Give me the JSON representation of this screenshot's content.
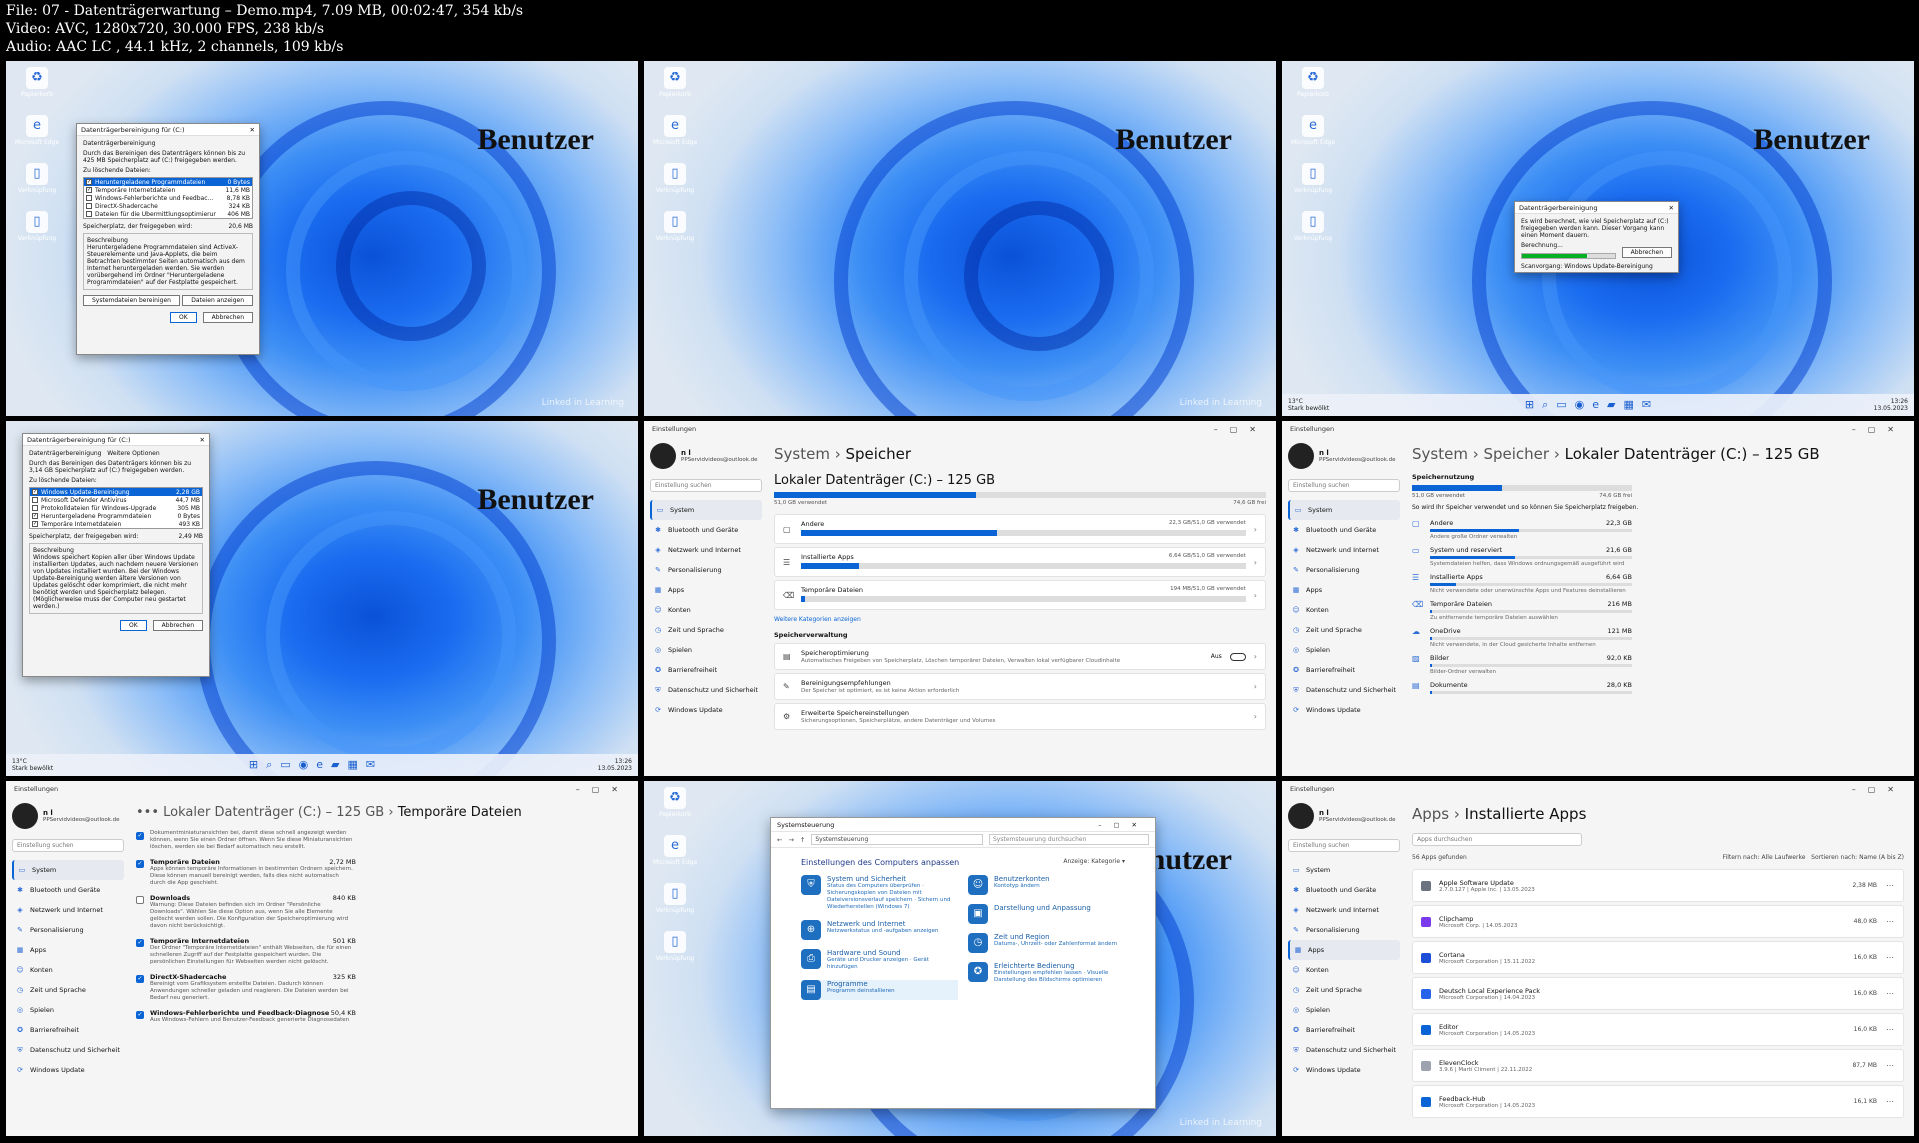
{
  "header": {
    "file_line": "File: 07 - Datenträgerwartung – Demo.mp4, 7.09 MB, 00:02:47, 354 kb/s",
    "video_line": "Video: AVC, 1280x720, 30.000 FPS, 238 kb/s",
    "audio_line": "Audio: AAC LC , 44.1 kHz, 2 channels, 109 kb/s"
  },
  "desktop": {
    "overlay_text": "Benutzer",
    "watermark": "Linked in Learning",
    "icons": [
      "Papierkorb",
      "Microsoft Edge",
      "Verknüpfung",
      "Verknüpfung"
    ],
    "taskbar": {
      "weather_temp": "13°C",
      "weather_desc": "Stark bewölkt",
      "time": "13:26",
      "date": "13.05.2023"
    }
  },
  "cleanup_dialog": {
    "title": "Datenträgerbereinigung für (C:)",
    "tab": "Datenträgerbereinigung",
    "intro": "Durch das Bereinigen des Datenträgers können bis zu 425 MB Speicherplatz auf (C:) freigegeben werden.",
    "files_label": "Zu löschende Dateien:",
    "files": [
      {
        "name": "Heruntergeladene Programmdateien",
        "size": "0 Bytes",
        "checked": true,
        "selected": true
      },
      {
        "name": "Temporäre Internetdateien",
        "size": "11,6 MB",
        "checked": true,
        "selected": false
      },
      {
        "name": "Windows-Fehlerberichte und Feedbac...",
        "size": "8,78 KB",
        "checked": false,
        "selected": false
      },
      {
        "name": "DirectX-Shadercache",
        "size": "324 KB",
        "checked": false,
        "selected": false
      },
      {
        "name": "Dateien für die Übermittlungsoptimierung",
        "size": "406 MB",
        "checked": false,
        "selected": false
      }
    ],
    "space_label": "Speicherplatz, der freigegeben wird:",
    "space_value": "20,6 MB",
    "desc_label": "Beschreibung",
    "desc_text": "Heruntergeladene Programmdateien sind ActiveX-Steuerelemente und Java-Applets, die beim Betrachten bestimmter Seiten automatisch aus dem Internet heruntergeladen werden. Sie werden vorübergehend im Ordner \"Heruntergeladene Programmdateien\" auf der Festplatte gespeichert.",
    "sys_button": "Systemdateien bereinigen",
    "view_button": "Dateien anzeigen",
    "ok": "OK",
    "cancel": "Abbrechen"
  },
  "progress_dialog": {
    "title": "Datenträgerbereinigung",
    "message": "Es wird berechnet, wie viel Speicherplatz auf (C:) freigegeben werden kann. Dieser Vorgang kann einen Moment dauern.",
    "calc_label": "Berechnung...",
    "cancel": "Abbrechen",
    "scan_label": "Scanvorgang:",
    "scan_item": "Windows Update-Bereinigung",
    "progress": 0.7
  },
  "cleanup_dialog2": {
    "title": "Datenträgerbereinigung für (C:)",
    "tabs": [
      "Datenträgerbereinigung",
      "Weitere Optionen"
    ],
    "intro": "Durch das Bereinigen des Datenträgers können bis zu 3,14 GB Speicherplatz auf (C:) freigegeben werden.",
    "files_label": "Zu löschende Dateien:",
    "files": [
      {
        "name": "Windows Update-Bereinigung",
        "size": "2,28 GB",
        "checked": true,
        "selected": true
      },
      {
        "name": "Microsoft Defender Antivirus",
        "size": "44,7 MB",
        "checked": false,
        "selected": false
      },
      {
        "name": "Protokolldateien für Windows-Upgrade",
        "size": "305 MB",
        "checked": false,
        "selected": false
      },
      {
        "name": "Heruntergeladene Programmdateien",
        "size": "0 Bytes",
        "checked": true,
        "selected": false
      },
      {
        "name": "Temporäre Internetdateien",
        "size": "493 KB",
        "checked": true,
        "selected": false
      }
    ],
    "space_label": "Speicherplatz, der freigegeben wird:",
    "space_value": "2,49 MB",
    "desc_label": "Beschreibung",
    "desc_text": "Windows speichert Kopien aller über Windows Update installierten Updates, auch nachdem neuere Versionen von Updates installiert wurden. Bei der Windows Update-Bereinigung werden ältere Versionen von Updates gelöscht oder komprimiert, die nicht mehr benötigt werden und Speicherplatz belegen. (Möglicherweise muss der Computer neu gestartet werden.)",
    "ok": "OK",
    "cancel": "Abbrechen"
  },
  "settings": {
    "app_title": "Einstellungen",
    "user_name": "n l",
    "user_email": "PPServidvideos@outlook.de",
    "search_placeholder": "Einstellung suchen",
    "nav": [
      "System",
      "Bluetooth und Geräte",
      "Netzwerk und Internet",
      "Personalisierung",
      "Apps",
      "Konten",
      "Zeit und Sprache",
      "Spielen",
      "Barrierefreiheit",
      "Datenschutz und Sicherheit",
      "Windows Update"
    ]
  },
  "storage_page": {
    "crumb_parent": "System",
    "crumb_current": "Speicher",
    "drive_title": "Lokaler Datenträger (C:) – 125 GB",
    "used": "51,0 GB verwendet",
    "free": "74,6 GB frei",
    "used_fraction": 0.41,
    "categories": [
      {
        "name": "Andere",
        "value": "22,3 GB/51,0 GB verwendet",
        "fraction": 0.44
      },
      {
        "name": "Installierte Apps",
        "value": "6,64 GB/51,0 GB verwendet",
        "fraction": 0.13
      },
      {
        "name": "Temporäre Dateien",
        "value": "194 MB/51,0 GB verwendet",
        "fraction": 0.01
      }
    ],
    "more_link": "Weitere Kategorien anzeigen",
    "mgmt_title": "Speicherverwaltung",
    "mgmt": [
      {
        "name": "Speicheroptimierung",
        "desc": "Automatisches Freigeben von Speicherplatz, Löschen temporärer Dateien, Verwalten lokal verfügbarer Cloudinhalte",
        "state": "Aus"
      },
      {
        "name": "Bereinigungsempfehlungen",
        "desc": "Der Speicher ist optimiert, es ist keine Aktion erforderlich",
        "state": ""
      },
      {
        "name": "Erweiterte Speichereinstellungen",
        "desc": "Sicherungsoptionen, Speicherplätze, andere Datenträger und Volumes",
        "state": ""
      }
    ]
  },
  "drive_page": {
    "crumb": [
      "System",
      "Speicher",
      "Lokaler Datenträger (C:) – 125 GB"
    ],
    "section": "Speichernutzung",
    "used": "51,0 GB verwendet",
    "free": "74,6 GB frei",
    "used_fraction": 0.41,
    "intro": "So wird Ihr Speicher verwendet und so können Sie Speicherplatz freigeben.",
    "items": [
      {
        "name": "Andere",
        "size": "22,3 GB",
        "desc": "Andere große Ordner verwalten",
        "fraction": 0.44
      },
      {
        "name": "System und reserviert",
        "size": "21,6 GB",
        "desc": "Systemdateien helfen, dass Windows ordnungsgemäß ausgeführt wird",
        "fraction": 0.42
      },
      {
        "name": "Installierte Apps",
        "size": "6,64 GB",
        "desc": "Nicht verwendete oder unerwünschte Apps und Features deinstallieren",
        "fraction": 0.13
      },
      {
        "name": "Temporäre Dateien",
        "size": "216 MB",
        "desc": "Zu entfernende temporäre Dateien auswählen",
        "fraction": 0.01
      },
      {
        "name": "OneDrive",
        "size": "121 MB",
        "desc": "Nicht verwendete, in der Cloud gesicherte Inhalte entfernen",
        "fraction": 0.01
      },
      {
        "name": "Bilder",
        "size": "92,0 KB",
        "desc": "Bilder-Ordner verwalten",
        "fraction": 0.005
      },
      {
        "name": "Dokumente",
        "size": "28,0 KB",
        "desc": "",
        "fraction": 0.003
      }
    ]
  },
  "temp_page": {
    "crumb_prefix": "•••",
    "crumb_parent": "Lokaler Datenträger (C:) – 125 GB",
    "crumb_current": "Temporäre Dateien",
    "lead": "Dokumentminiaturansichten bei, damit diese schnell angezeigt werden können, wenn Sie einen Ordner öffnen. Wenn Sie diese Miniaturansichten löschen, werden sie bei Bedarf automatisch neu erstellt.",
    "items": [
      {
        "name": "Temporäre Dateien",
        "size": "2,72 MB",
        "checked": true,
        "desc": "Apps können temporäre Informationen in bestimmten Ordnern speichern. Diese können manuell bereinigt werden, falls dies nicht automatisch durch die App geschieht."
      },
      {
        "name": "Downloads",
        "size": "840 KB",
        "checked": false,
        "desc": "Warnung: Diese Dateien befinden sich im Ordner \"Persönliche Downloads\". Wählen Sie diese Option aus, wenn Sie alle Elemente gelöscht werden sollen. Die Konfiguration der Speicheroptimierung wird davon nicht berücksichtigt."
      },
      {
        "name": "Temporäre Internetdateien",
        "size": "501 KB",
        "checked": true,
        "desc": "Der Ordner \"Temporäre Internetdateien\" enthält Webseiten, die für einen schnelleren Zugriff auf der Festplatte gespeichert wurden. Die persönlichen Einstellungen für Webseiten werden nicht gelöscht."
      },
      {
        "name": "DirectX-Shadercache",
        "size": "325 KB",
        "checked": true,
        "desc": "Bereinigt vom Grafiksystem erstellte Dateien. Dadurch können Anwendungen schneller geladen und reagieren. Die Dateien werden bei Bedarf neu generiert."
      },
      {
        "name": "Windows-Fehlerberichte und Feedback-Diagnose",
        "size": "50,4 KB",
        "checked": true,
        "desc": "Aus Windows-Fehlern und Benutzer-Feedback generierte Diagnosedaten"
      }
    ]
  },
  "control_panel": {
    "title": "Systemsteuerung",
    "address": "Systemsteuerung",
    "search_placeholder": "Systemsteuerung durchsuchen",
    "heading": "Einstellungen des Computers anpassen",
    "view_label": "Anzeige:",
    "view_value": "Kategorie ▾",
    "left": [
      {
        "name": "System und Sicherheit",
        "links": "Status des Computers überprüfen · Sicherungskopien von Dateien mit Dateiversionsverlauf speichern · Sichern und Wiederherstellen (Windows 7)",
        "icon": "shield-icon",
        "glyph": "⛨"
      },
      {
        "name": "Netzwerk und Internet",
        "links": "Netzwerkstatus und -aufgaben anzeigen",
        "icon": "network-icon",
        "glyph": "⊕"
      },
      {
        "name": "Hardware und Sound",
        "links": "Geräte und Drucker anzeigen · Gerät hinzufügen",
        "icon": "printer-icon",
        "glyph": "⎙"
      },
      {
        "name": "Programme",
        "links": "Programm deinstallieren",
        "icon": "programs-icon",
        "glyph": "▤"
      }
    ],
    "right": [
      {
        "name": "Benutzerkonten",
        "links": "Kontotyp ändern",
        "icon": "user-icon",
        "glyph": "☺"
      },
      {
        "name": "Darstellung und Anpassung",
        "links": "",
        "icon": "display-icon",
        "glyph": "▣"
      },
      {
        "name": "Zeit und Region",
        "links": "Datums-, Uhrzeit- oder Zahlenformat ändern",
        "icon": "clock-icon",
        "glyph": "◷"
      },
      {
        "name": "Erleichterte Bedienung",
        "links": "Einstellungen empfehlen lassen · Visuelle Darstellung des Bildschirms optimieren",
        "icon": "accessibility-icon",
        "glyph": "✪"
      }
    ]
  },
  "apps_page": {
    "crumb_parent": "Apps",
    "crumb_current": "Installierte Apps",
    "search_placeholder": "Apps durchsuchen",
    "count": "56 Apps gefunden",
    "filter_label": "Filtern nach:",
    "filter_value": "Alle Laufwerke",
    "sort_label": "Sortieren nach:",
    "sort_value": "Name (A bis Z)",
    "apps": [
      {
        "name": "Apple Software Update",
        "meta": "2.7.0.127 | Apple Inc. | 13.05.2023",
        "size": "2,38 MB"
      },
      {
        "name": "Clipchamp",
        "meta": "Microsoft Corp. | 14.05.2023",
        "size": "48,0 KB"
      },
      {
        "name": "Cortana",
        "meta": "Microsoft Corporation | 15.11.2022",
        "size": "16,0 KB"
      },
      {
        "name": "Deutsch Local Experience Pack",
        "meta": "Microsoft Corporation | 14.04.2023",
        "size": "16,0 KB"
      },
      {
        "name": "Editor",
        "meta": "Microsoft Corporation | 14.05.2023",
        "size": "16,0 KB"
      },
      {
        "name": "ElevenClock",
        "meta": "3.9.6 | Martí Climent | 22.11.2022",
        "size": "87,7 MB"
      },
      {
        "name": "Feedback-Hub",
        "meta": "Microsoft Corporation | 14.05.2023",
        "size": "16,1 KB"
      }
    ]
  }
}
